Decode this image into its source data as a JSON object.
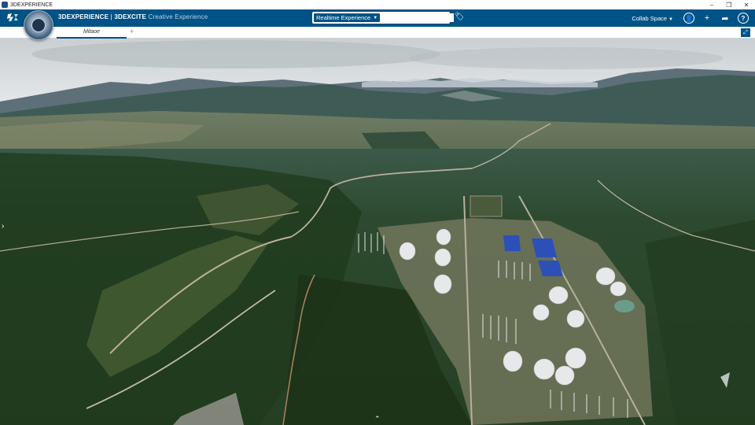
{
  "os": {
    "title": "3DEXPERIENCE",
    "min": "–",
    "restore": "❐",
    "close": "✕"
  },
  "app": {
    "brand_main": "3DEXPERIENCE",
    "brand_sep": " | ",
    "brand_app": "3DEXCITE",
    "brand_sub": " Creative Experience",
    "compass_icon": "compass-icon"
  },
  "search": {
    "context_label": "Realtime Experience",
    "value": "",
    "placeholder": ""
  },
  "header": {
    "collab_space": "Collab Space",
    "icons": [
      "user-icon",
      "plus-icon",
      "share-icon",
      "help-icon"
    ]
  },
  "tabs": [
    {
      "label": "Mitaoe"
    }
  ],
  "tab_add": "+",
  "colors": {
    "brand_blue": "#005386",
    "panel_blue": "#2c50b8"
  }
}
